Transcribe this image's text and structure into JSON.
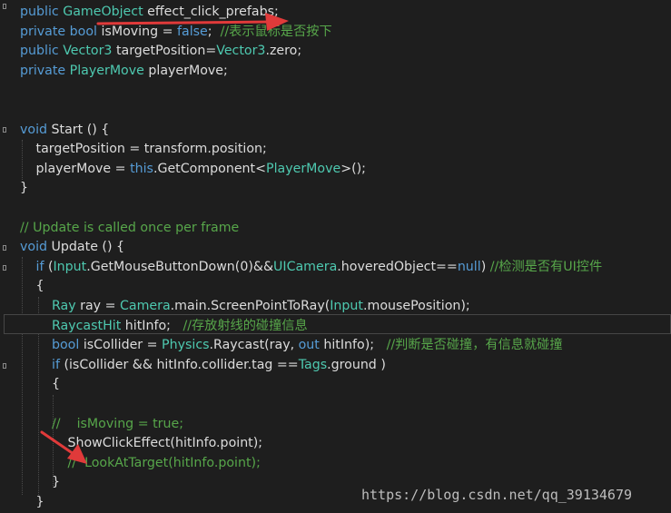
{
  "editor": {
    "language": "csharp",
    "colors": {
      "background": "#1e1e1e",
      "keyword": "#569cd6",
      "type": "#4ec9b0",
      "comment": "#57a64a",
      "text": "#dcdcdc",
      "arrow": "#e03a3a"
    },
    "lines": [
      {
        "indent": 0,
        "tokens": [
          {
            "c": "kw",
            "t": "public "
          },
          {
            "c": "ty",
            "t": "GameObject"
          },
          {
            "c": "pl",
            "t": " effect_click_prefabs;"
          }
        ]
      },
      {
        "indent": 0,
        "tokens": [
          {
            "c": "kw",
            "t": "private bool"
          },
          {
            "c": "pl",
            "t": " isMoving = "
          },
          {
            "c": "kw",
            "t": "false"
          },
          {
            "c": "pl",
            "t": ";  "
          },
          {
            "c": "cm",
            "t": "//表示鼠标是否按下"
          }
        ]
      },
      {
        "indent": 0,
        "tokens": [
          {
            "c": "kw",
            "t": "public "
          },
          {
            "c": "ty",
            "t": "Vector3"
          },
          {
            "c": "pl",
            "t": " targetPosition="
          },
          {
            "c": "ty",
            "t": "Vector3"
          },
          {
            "c": "pl",
            "t": ".zero;"
          }
        ]
      },
      {
        "indent": 0,
        "tokens": [
          {
            "c": "kw",
            "t": "private "
          },
          {
            "c": "ty",
            "t": "PlayerMove"
          },
          {
            "c": "pl",
            "t": " playerMove;"
          }
        ]
      },
      {
        "indent": 0,
        "tokens": []
      },
      {
        "indent": 0,
        "tokens": []
      },
      {
        "indent": 0,
        "tokens": [
          {
            "c": "kw",
            "t": "void"
          },
          {
            "c": "pl",
            "t": " Start () {"
          }
        ]
      },
      {
        "indent": 1,
        "tokens": [
          {
            "c": "pl",
            "t": "targetPosition = transform.position;"
          }
        ]
      },
      {
        "indent": 1,
        "tokens": [
          {
            "c": "pl",
            "t": "playerMove = "
          },
          {
            "c": "kw",
            "t": "this"
          },
          {
            "c": "pl",
            "t": ".GetComponent<"
          },
          {
            "c": "ty",
            "t": "PlayerMove"
          },
          {
            "c": "pl",
            "t": ">();"
          }
        ]
      },
      {
        "indent": 0,
        "tokens": [
          {
            "c": "pl",
            "t": "}"
          }
        ]
      },
      {
        "indent": 0,
        "tokens": []
      },
      {
        "indent": 0,
        "tokens": [
          {
            "c": "cm",
            "t": "// Update is called once per frame"
          }
        ]
      },
      {
        "indent": 0,
        "tokens": [
          {
            "c": "kw",
            "t": "void"
          },
          {
            "c": "pl",
            "t": " Update () {"
          }
        ]
      },
      {
        "indent": 1,
        "tokens": [
          {
            "c": "kw",
            "t": "if"
          },
          {
            "c": "pl",
            "t": " ("
          },
          {
            "c": "ty",
            "t": "Input"
          },
          {
            "c": "pl",
            "t": ".GetMouseButtonDown(0)&&"
          },
          {
            "c": "ty",
            "t": "UICamera"
          },
          {
            "c": "pl",
            "t": ".hoveredObject=="
          },
          {
            "c": "kw",
            "t": "null"
          },
          {
            "c": "pl",
            "t": ") "
          },
          {
            "c": "cm",
            "t": "//检测是否有UI控件"
          }
        ]
      },
      {
        "indent": 1,
        "tokens": [
          {
            "c": "pl",
            "t": "{"
          }
        ]
      },
      {
        "indent": 2,
        "tokens": [
          {
            "c": "ty",
            "t": "Ray"
          },
          {
            "c": "pl",
            "t": " ray = "
          },
          {
            "c": "ty",
            "t": "Camera"
          },
          {
            "c": "pl",
            "t": ".main.ScreenPointToRay("
          },
          {
            "c": "ty",
            "t": "Input"
          },
          {
            "c": "pl",
            "t": ".mousePosition);"
          }
        ]
      },
      {
        "indent": 2,
        "tokens": [
          {
            "c": "ty",
            "t": "RaycastHit"
          },
          {
            "c": "pl",
            "t": " hitInfo;   "
          },
          {
            "c": "cm",
            "t": "//存放射线的碰撞信息"
          }
        ]
      },
      {
        "indent": 2,
        "tokens": [
          {
            "c": "kw",
            "t": "bool"
          },
          {
            "c": "pl",
            "t": " isCollider = "
          },
          {
            "c": "ty",
            "t": "Physics"
          },
          {
            "c": "pl",
            "t": ".Raycast(ray, "
          },
          {
            "c": "kw",
            "t": "out"
          },
          {
            "c": "pl",
            "t": " hitInfo);   "
          },
          {
            "c": "cm",
            "t": "//判断是否碰撞，有信息就碰撞"
          }
        ]
      },
      {
        "indent": 2,
        "tokens": [
          {
            "c": "kw",
            "t": "if"
          },
          {
            "c": "pl",
            "t": " (isCollider && hitInfo.collider.tag =="
          },
          {
            "c": "ty",
            "t": "Tags"
          },
          {
            "c": "pl",
            "t": ".ground )"
          }
        ]
      },
      {
        "indent": 2,
        "tokens": [
          {
            "c": "pl",
            "t": "{"
          }
        ]
      },
      {
        "indent": 0,
        "tokens": []
      },
      {
        "indent": 2,
        "tokens": [
          {
            "c": "cm",
            "t": "//    isMoving = true;"
          }
        ]
      },
      {
        "indent": 3,
        "tokens": [
          {
            "c": "pl",
            "t": "ShowClickEffect(hitInfo.point);"
          }
        ]
      },
      {
        "indent": 3,
        "tokens": [
          {
            "c": "cm",
            "t": "//  LookAtTarget(hitInfo.point);"
          }
        ]
      },
      {
        "indent": 2,
        "tokens": [
          {
            "c": "pl",
            "t": "}"
          }
        ]
      },
      {
        "indent": 1,
        "tokens": [
          {
            "c": "pl",
            "t": "}"
          }
        ]
      }
    ]
  },
  "watermark": "https://blog.csdn.net/qq_39134679",
  "annotations": [
    {
      "name": "arrow-to-effect-click-prefabs"
    },
    {
      "name": "arrow-to-show-click-effect"
    }
  ]
}
